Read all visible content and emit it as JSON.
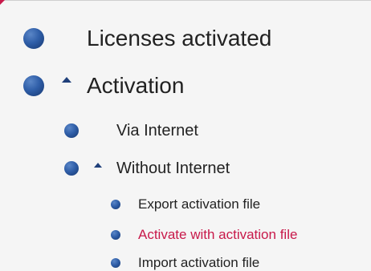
{
  "tree": {
    "licenses_activated": {
      "label": "Licenses activated",
      "bullet_icon": "bullet-icon",
      "bullet_color": "#2f5ea8"
    },
    "activation": {
      "label": "Activation",
      "expanded": true,
      "caret_icon": "caret-up-icon",
      "children": {
        "via_internet": {
          "label": "Via Internet"
        },
        "without_internet": {
          "label": "Without Internet",
          "expanded": true,
          "caret_icon": "caret-up-icon",
          "children": [
            {
              "label": "Export activation file",
              "active": false
            },
            {
              "label": "Activate with activation file",
              "active": true,
              "color": "#c8194a"
            },
            {
              "label": "Import activation file",
              "active": false
            }
          ]
        }
      }
    }
  }
}
